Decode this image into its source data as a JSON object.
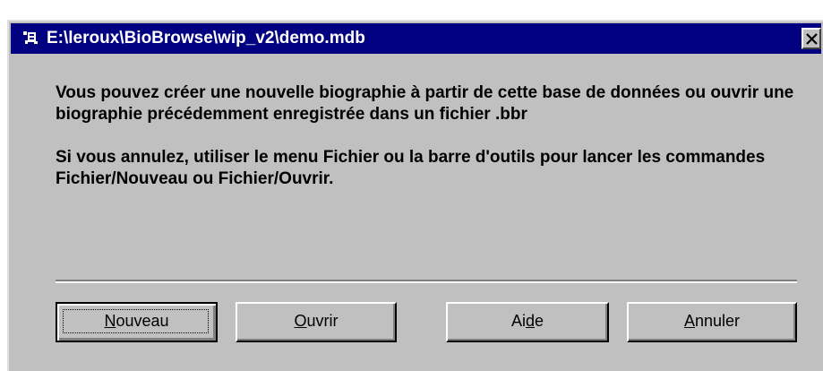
{
  "window": {
    "title": "E:\\leroux\\BioBrowse\\wip_v2\\demo.mdb",
    "icon": "app-icon",
    "close_icon": "close-icon"
  },
  "message": {
    "paragraph1": "Vous pouvez créer une nouvelle biographie à partir de cette base de données ou ouvrir une biographie précédemment enregistrée dans un fichier .bbr",
    "paragraph2": "Si vous annulez, utiliser le menu Fichier ou la barre d'outils pour lancer les commandes Fichier/Nouveau ou Fichier/Ouvrir."
  },
  "buttons": {
    "nouveau": {
      "label": "Nouveau",
      "accel_before": "",
      "accel_key": "N",
      "accel_after": "ouveau",
      "default": true
    },
    "ouvrir": {
      "label": "Ouvrir",
      "accel_before": "",
      "accel_key": "O",
      "accel_after": "uvrir"
    },
    "aide": {
      "label": "Aide",
      "accel_before": "Ai",
      "accel_key": "d",
      "accel_after": "e"
    },
    "annuler": {
      "label": "Annuler",
      "accel_before": "",
      "accel_key": "A",
      "accel_after": "nnuler"
    }
  }
}
